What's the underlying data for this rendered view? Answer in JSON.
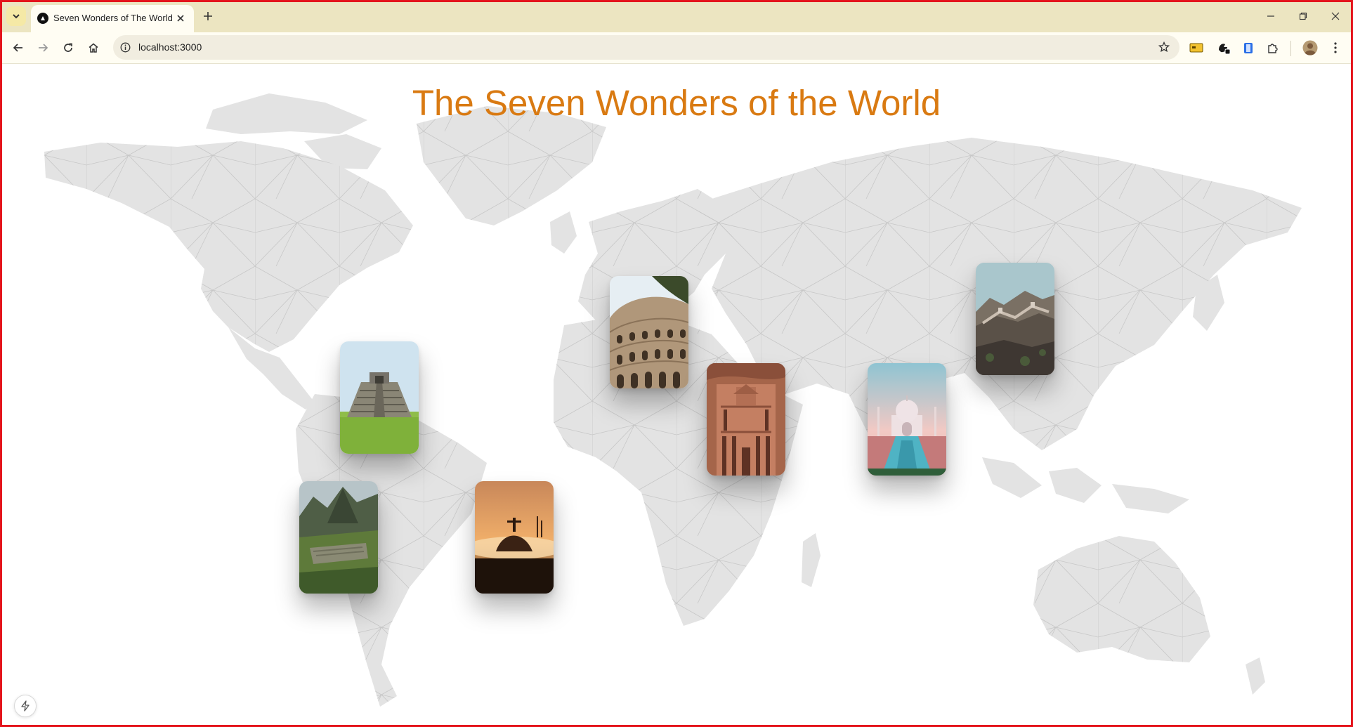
{
  "browser": {
    "tab_title": "Seven Wonders of The World",
    "url": "localhost:3000",
    "icons": {
      "tab_search": "chevron-down-icon",
      "favicon": "nextjs-logo-icon",
      "close": "close-icon",
      "new_tab": "plus-icon",
      "back": "arrow-left-icon",
      "forward": "arrow-right-icon",
      "reload": "reload-icon",
      "home": "home-icon",
      "site_info": "info-icon",
      "bookmark": "star-icon",
      "extensions": [
        "card-extension-icon",
        "wallet-extension-icon",
        "clipboard-extension-icon",
        "puzzle-icon"
      ],
      "profile": "avatar",
      "menu": "kebab-menu-icon",
      "window": [
        "minimize-icon",
        "restore-icon",
        "close-window-icon"
      ]
    }
  },
  "page": {
    "title": "The Seven Wonders of the World",
    "title_color": "#d97a12",
    "background": "world-map",
    "wonders": [
      {
        "id": "chichen-itza",
        "image": "stepped pyramid on green lawn"
      },
      {
        "id": "machu-picchu",
        "image": "mountain ruins"
      },
      {
        "id": "christ-the-redeemer",
        "image": "statue above clouds at sunset"
      },
      {
        "id": "colosseum",
        "image": "ancient amphitheatre"
      },
      {
        "id": "petra",
        "image": "rock-carved treasury"
      },
      {
        "id": "taj-mahal",
        "image": "white marble mausoleum with reflecting pool"
      },
      {
        "id": "great-wall",
        "image": "wall over mountains"
      }
    ]
  },
  "dev_indicator_icon": "lightning-icon"
}
